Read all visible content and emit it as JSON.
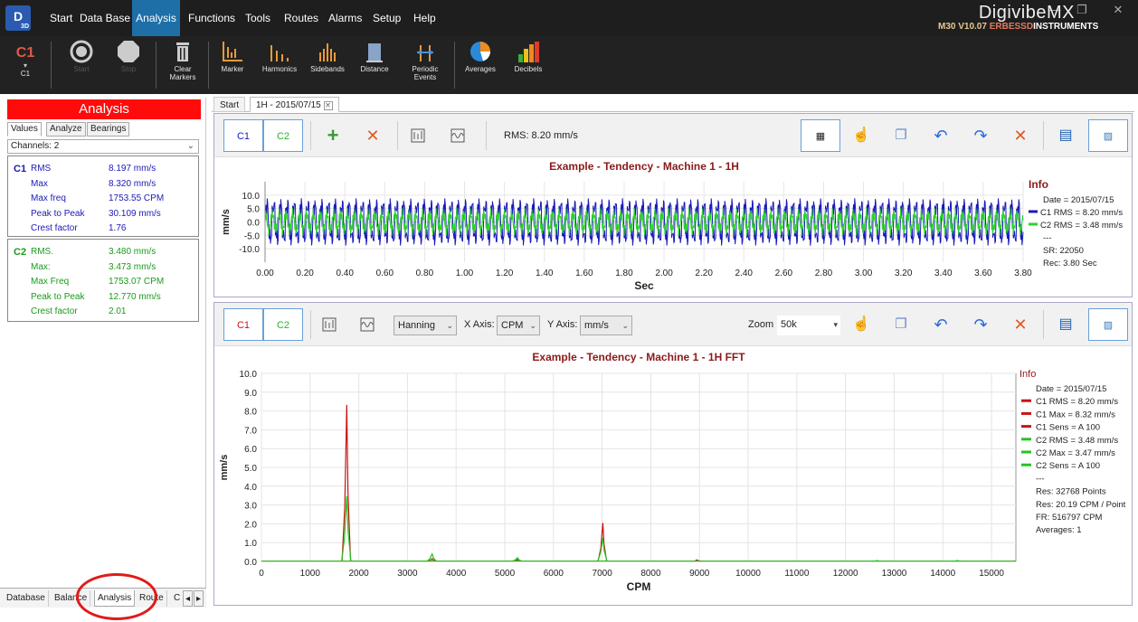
{
  "menu": {
    "logo_text": "D",
    "logo_sub": "3D",
    "items": [
      "Start",
      "Data Base",
      "Analysis",
      "Functions",
      "Tools",
      "Routes",
      "Alarms",
      "Setup",
      "Help"
    ],
    "active": "Analysis"
  },
  "brand": {
    "name": "DigivibeMX",
    "version": "M30 V10.07",
    "company_prefix": "ERBESSD",
    "company_suffix": "INSTRUMENTS"
  },
  "ribbon": {
    "channel": "C1",
    "channel_sub": "C1",
    "buttons": [
      "Start",
      "Stop",
      "Clear Markers",
      "Marker",
      "Harmonics",
      "Sidebands",
      "Distance",
      "Periodic Events",
      "Averages",
      "Decibels"
    ]
  },
  "left_panel": {
    "title": "Analysis",
    "tabs": [
      "Values",
      "Analyze",
      "Bearings"
    ],
    "channels_select": "Channels: 2",
    "c1": {
      "label": "C1",
      "rows": [
        {
          "name": "RMS",
          "value": "8.197 mm/s"
        },
        {
          "name": "Max",
          "value": "8.320 mm/s"
        },
        {
          "name": "Max freq",
          "value": "1753.55 CPM"
        },
        {
          "name": "Peak to Peak",
          "value": "30.109 mm/s"
        },
        {
          "name": "Crest factor",
          "value": "1.76"
        }
      ]
    },
    "c2": {
      "label": "C2",
      "rows": [
        {
          "name": "RMS.",
          "value": "3.480 mm/s"
        },
        {
          "name": "Max:",
          "value": "3.473 mm/s"
        },
        {
          "name": "Max Freq",
          "value": "1753.07 CPM"
        },
        {
          "name": "Peak to Peak",
          "value": "12.770 mm/s"
        },
        {
          "name": "Crest factor",
          "value": "2.01"
        }
      ]
    },
    "bottom_tabs": [
      "Database",
      "Balance",
      "Analysis",
      "Route",
      "C"
    ]
  },
  "doc_tabs": [
    "Start",
    "1H - 2015/07/15"
  ],
  "top_panel": {
    "c1": "C1",
    "c2": "C2",
    "rms_text": "RMS: 8.20 mm/s"
  },
  "bottom_panel": {
    "c1": "C1",
    "c2": "C2",
    "window": "Hanning",
    "x_axis_label": "X Axis:",
    "x_axis_value": "CPM",
    "y_axis_label": "Y Axis:",
    "y_axis_value": "mm/s",
    "zoom_label": "Zoom",
    "zoom_value": "50k"
  },
  "colors": {
    "c1": "#1a1ab8",
    "c2": "#2bd42b",
    "fft_c1": "#c81414",
    "fft_c2": "#22c422",
    "title": "#8b1a1a",
    "accent": "#1e6fa8"
  },
  "time_chart": {
    "title": "Example - Tendency - Machine 1 - 1H",
    "xlabel": "Sec",
    "ylabel": "mm/s",
    "xticks": [
      "0.00",
      "0.20",
      "0.40",
      "0.60",
      "0.80",
      "1.00",
      "1.20",
      "1.40",
      "1.60",
      "1.80",
      "2.00",
      "2.20",
      "2.40",
      "2.60",
      "2.80",
      "3.00",
      "3.20",
      "3.40",
      "3.60",
      "3.80"
    ],
    "yticks": [
      "10.0",
      "5.0",
      "0.0",
      "-5.0",
      "-10.0"
    ],
    "info_title": "Info",
    "info": [
      "Date = 2015/07/15",
      "C1 RMS = 8.20 mm/s",
      "C2 RMS = 3.48 mm/s",
      "---",
      "SR: 22050",
      "Rec: 3.80 Sec"
    ]
  },
  "chart_data": [
    {
      "type": "line",
      "title": "Example - Tendency - Machine 1 - 1H",
      "xlabel": "Sec",
      "ylabel": "mm/s",
      "xlim": [
        0,
        3.8
      ],
      "ylim": [
        -15,
        15
      ],
      "series": [
        {
          "name": "C1 RMS = 8.20 mm/s",
          "color": "#1a1ab8",
          "frequency_hz": 29.2,
          "amplitude": 12.5
        },
        {
          "name": "C2 RMS = 3.48 mm/s",
          "color": "#2bd42b",
          "frequency_hz": 29.2,
          "amplitude": 5.2
        }
      ]
    },
    {
      "type": "line",
      "title": "Example - Tendency - Machine 1 - 1H FFT",
      "xlabel": "CPM",
      "ylabel": "mm/s",
      "xlim": [
        0,
        15500
      ],
      "ylim": [
        0,
        10
      ],
      "xticks": [
        "0",
        "1000",
        "2000",
        "3000",
        "4000",
        "5000",
        "6000",
        "7000",
        "8000",
        "9000",
        "10000",
        "11000",
        "12000",
        "13000",
        "14000",
        "15000"
      ],
      "yticks": [
        "10.0",
        "9.0",
        "8.0",
        "7.0",
        "6.0",
        "5.0",
        "4.0",
        "3.0",
        "2.0",
        "1.0",
        "0.0"
      ],
      "series": [
        {
          "name": "C1",
          "color": "#c81414",
          "peaks": [
            [
              1753,
              8.32
            ],
            [
              7014,
              2.05
            ],
            [
              3507,
              0.15
            ],
            [
              5260,
              0.1
            ],
            [
              8950,
              0.08
            ]
          ]
        },
        {
          "name": "C2",
          "color": "#22c422",
          "peaks": [
            [
              1753,
              3.47
            ],
            [
              7014,
              1.25
            ],
            [
              3507,
              0.4
            ],
            [
              5260,
              0.2
            ],
            [
              12650,
              0.05
            ],
            [
              14300,
              0.05
            ]
          ]
        }
      ],
      "info_title": "Info",
      "info": [
        "Date = 2015/07/15",
        "C1 RMS = 8.20 mm/s",
        "C1 Max = 8.32 mm/s",
        "C1 Sens = A 100",
        "C2 RMS = 3.48 mm/s",
        "C2 Max = 3.47 mm/s",
        "C2 Sens = A 100",
        "---",
        "Res: 32768 Points",
        "Res: 20.19 CPM / Point",
        "FR: 516797 CPM",
        "Averages: 1"
      ]
    }
  ]
}
